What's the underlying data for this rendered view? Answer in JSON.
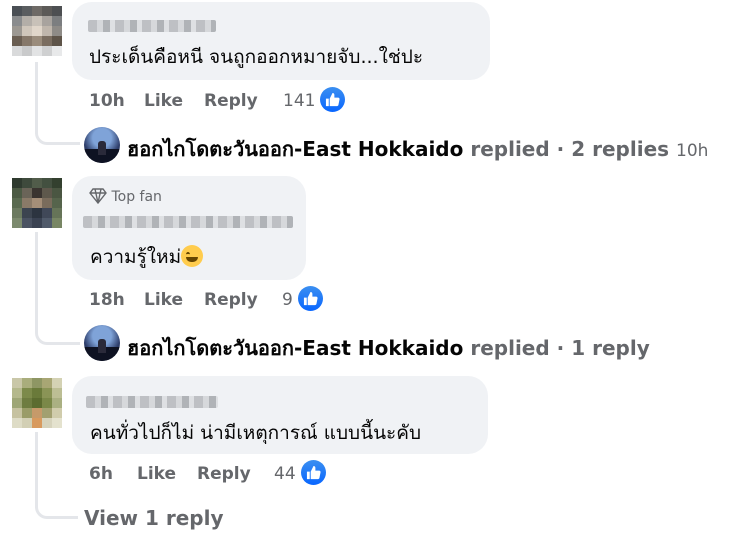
{
  "comments": [
    {
      "text": "ประเด็นคือหนี จนถูกออกหมายจับ...ใช่ปะ",
      "time": "10h",
      "like_label": "Like",
      "reply_label": "Reply",
      "reaction_count": "141",
      "replies_summary": {
        "replier_name": "ฮอกไกโดตะวันออก-East Hokkaido",
        "action": "replied",
        "separator": "·",
        "count_label": "2 replies",
        "time": "10h"
      }
    },
    {
      "badge": "Top fan",
      "text": "ความรู้ใหม่",
      "time": "18h",
      "like_label": "Like",
      "reply_label": "Reply",
      "reaction_count": "9",
      "replies_summary": {
        "replier_name": "ฮอกไกโดตะวันออก-East Hokkaido",
        "action": "replied",
        "separator": "·",
        "count_label": "1 reply"
      }
    },
    {
      "text": "คนทั่วไปก็ไม่ น่ามีเหตุการณ์ แบบนี้นะคับ",
      "time": "6h",
      "like_label": "Like",
      "reply_label": "Reply",
      "reaction_count": "44",
      "view_replies_label": "View 1 reply"
    }
  ],
  "colors": {
    "bubble": "#f0f2f5",
    "secondary_text": "#65676b",
    "like_blue": "#0866ff"
  },
  "icons": {
    "reaction": "like-thumb-icon",
    "badge": "diamond-icon"
  }
}
